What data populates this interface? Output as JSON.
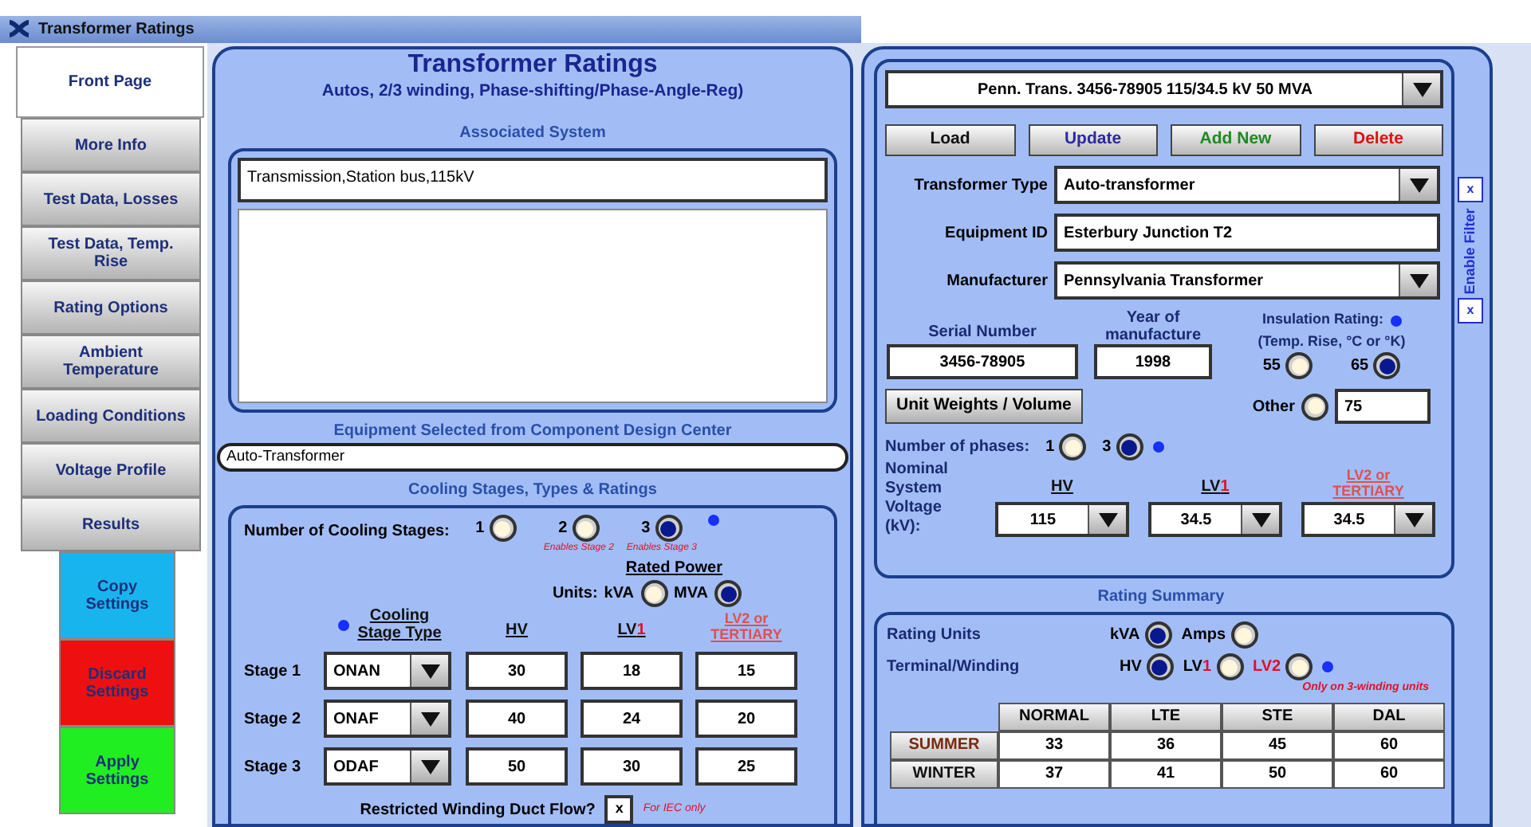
{
  "window": {
    "title": "Transformer Ratings"
  },
  "sidebar": {
    "tabs": [
      {
        "label": "Front Page",
        "selected": true
      },
      {
        "label": "More Info",
        "selected": false
      },
      {
        "label": "Test Data, Losses",
        "selected": false
      },
      {
        "label": "Test Data, Temp. Rise",
        "selected": false
      },
      {
        "label": "Rating Options",
        "selected": false
      },
      {
        "label": "Ambient Temperature",
        "selected": false
      },
      {
        "label": "Loading Conditions",
        "selected": false
      },
      {
        "label": "Voltage Profile",
        "selected": false
      },
      {
        "label": "Results",
        "selected": false
      }
    ],
    "actions": [
      {
        "label": "Copy Settings",
        "color": "#18b4ee"
      },
      {
        "label": "Discard Settings",
        "color": "#ee1010"
      },
      {
        "label": "Apply Settings",
        "color": "#20ee20"
      }
    ]
  },
  "header": {
    "title": "Transformer Ratings",
    "subtitle": "Autos, 2/3 winding, Phase-shifting/Phase-Angle-Reg)"
  },
  "associated_system": {
    "heading": "Associated System",
    "value": "Transmission,Station bus,115kV"
  },
  "equipment_selected": {
    "heading": "Equipment Selected from Component Design Center",
    "value": "Auto-Transformer"
  },
  "cooling": {
    "heading": "Cooling Stages, Types & Ratings",
    "stages_label": "Number of Cooling Stages:",
    "stage_options": [
      {
        "label": "1",
        "selected": false
      },
      {
        "label": "2",
        "selected": false,
        "note": "Enables Stage 2"
      },
      {
        "label": "3",
        "selected": true,
        "note": "Enables Stage 3"
      }
    ],
    "rated_power": "Rated Power",
    "units_label": "Units:",
    "unit_options": [
      {
        "label": "kVA",
        "selected": false
      },
      {
        "label": "MVA",
        "selected": true
      }
    ],
    "columns": [
      {
        "label": "Cooling Stage Type",
        "kind": "type"
      },
      {
        "label": "HV",
        "kind": "plain"
      },
      {
        "label": "LV",
        "accent": "1",
        "kind": "accent"
      },
      {
        "label": "LV2 or TERTIARY",
        "kind": "warn"
      }
    ],
    "rows": [
      {
        "label": "Stage 1",
        "type": "ONAN",
        "values": [
          "30",
          "18",
          "15"
        ]
      },
      {
        "label": "Stage 2",
        "type": "ONAF",
        "values": [
          "40",
          "24",
          "20"
        ]
      },
      {
        "label": "Stage 3",
        "type": "ODAF",
        "values": [
          "50",
          "30",
          "25"
        ]
      }
    ],
    "duct_flow": {
      "label": "Restricted Winding Duct Flow?",
      "value": "x",
      "checked": true,
      "note": "For IEC only"
    }
  },
  "record": {
    "value": "Penn. Trans. 3456-78905 115/34.5 kV 50 MVA",
    "filter_label": "Enable Filter",
    "buttons": [
      {
        "label": "Load",
        "color": "#111111"
      },
      {
        "label": "Update",
        "color": "#2a2aa0"
      },
      {
        "label": "Add New",
        "color": "#1f8a1f"
      },
      {
        "label": "Delete",
        "color": "#e01010"
      }
    ]
  },
  "fields": [
    {
      "label": "Transformer Type",
      "value": "Auto-transformer",
      "kind": "dropdown",
      "filter": "x",
      "filter_checked": true
    },
    {
      "label": "Equipment ID",
      "value": "Esterbury Junction T2",
      "kind": "text"
    },
    {
      "label": "Manufacturer",
      "value": "Pennsylvania Transformer",
      "kind": "dropdown",
      "filter": "x",
      "filter_checked": true
    }
  ],
  "serial": {
    "label": "Serial Number",
    "value": "3456-78905"
  },
  "year": {
    "label": "Year of manufacture",
    "value": "1998"
  },
  "insulation": {
    "label": "Insulation Rating:",
    "sublabel": "(Temp. Rise, °C or °K)",
    "options": [
      {
        "label": "55",
        "selected": false
      },
      {
        "label": "65",
        "selected": true
      }
    ],
    "other": {
      "label": "Other",
      "selected": false,
      "value": "75"
    }
  },
  "unit_weights_button": "Unit Weights / Volume",
  "phases": {
    "label": "Number of phases:",
    "options": [
      {
        "label": "1",
        "selected": false
      },
      {
        "label": "3",
        "selected": true
      }
    ]
  },
  "nominal_voltage": {
    "label": "Nominal System Voltage (kV):",
    "columns": [
      {
        "label": "HV",
        "kind": "plain",
        "value": "115"
      },
      {
        "label": "LV",
        "accent": "1",
        "kind": "accent",
        "value": "34.5"
      },
      {
        "label": "LV2 or TERTIARY",
        "kind": "warn",
        "value": "34.5"
      }
    ]
  },
  "rating_summary": {
    "heading": "Rating Summary",
    "units_label": "Rating Units",
    "unit_options": [
      {
        "label": "kVA",
        "selected": true
      },
      {
        "label": "Amps",
        "selected": false
      }
    ],
    "winding_label": "Terminal/Winding",
    "winding_options": [
      {
        "label": "HV",
        "kind": "plain",
        "selected": true
      },
      {
        "label": "LV",
        "accent": "1",
        "kind": "accent",
        "selected": false
      },
      {
        "label": "LV2",
        "kind": "warn",
        "selected": false
      }
    ],
    "winding_note": "Only on 3-winding units",
    "table": {
      "columns": [
        "NORMAL",
        "LTE",
        "STE",
        "DAL"
      ],
      "rows": [
        {
          "label": "SUMMER",
          "kind": "summer",
          "values": [
            "33",
            "36",
            "45",
            "60"
          ]
        },
        {
          "label": "WINTER",
          "kind": "winter",
          "values": [
            "37",
            "41",
            "50",
            "60"
          ]
        }
      ]
    }
  }
}
